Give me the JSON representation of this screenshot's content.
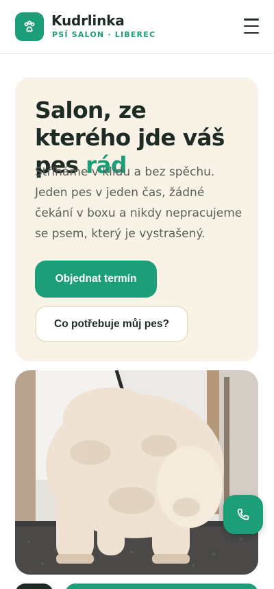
{
  "header": {
    "brand_name": "Kudrlinka",
    "brand_subtitle": "PSÍ SALON · LIBEREC",
    "logo_icon": "paw-icon",
    "menu_icon": "hamburger-menu-icon"
  },
  "hero": {
    "title_main": "Salon, ze kterého jde váš pes ",
    "title_accent": "rád",
    "description": "Stříháme v klidu a bez spěchu. Jeden pes v jeden čas, žádné čekání v boxu a nikdy nepracujeme se psem, který je vystrašený.",
    "primary_button": "Objednat termín",
    "secondary_button": "Co potřebuje můj pes?"
  },
  "photo": {
    "subject": "groomed-white-poodle-photo"
  },
  "fab": {
    "icon": "phone-icon"
  },
  "colors": {
    "accent": "#1c9e78",
    "hero_background": "#f8f3e6",
    "text_dark": "#1e2a24",
    "text_muted": "#5b5f5b"
  }
}
